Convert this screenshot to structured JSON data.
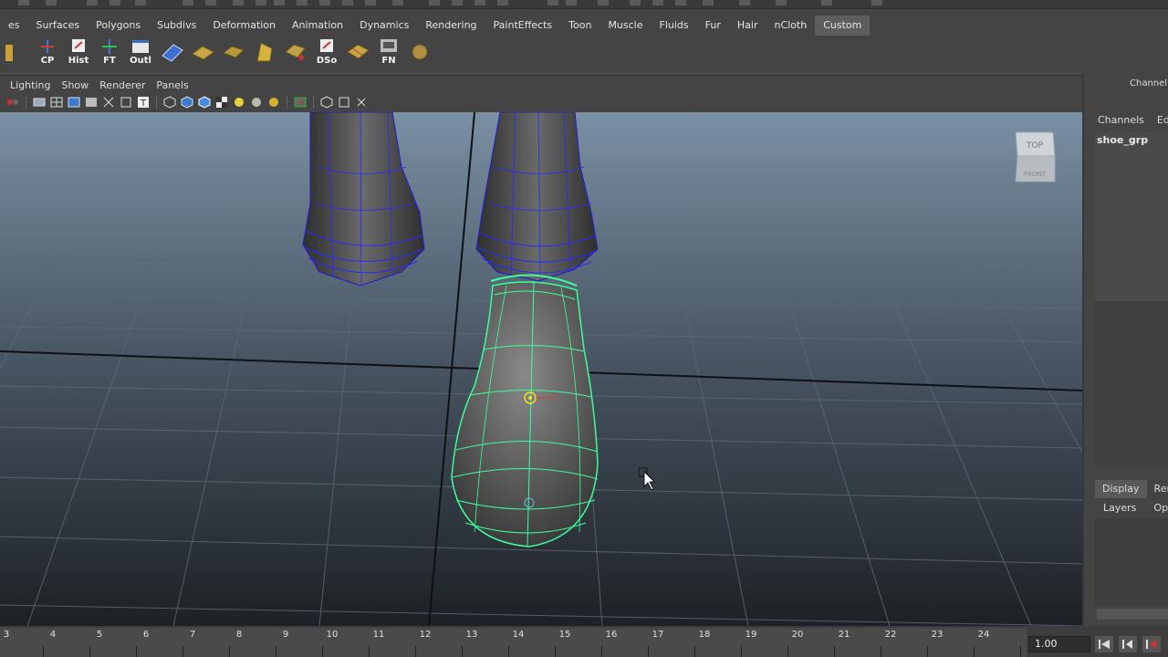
{
  "shelf_tabs": [
    "es",
    "Surfaces",
    "Polygons",
    "Subdivs",
    "Deformation",
    "Animation",
    "Dynamics",
    "Rendering",
    "PaintEffects",
    "Toon",
    "Muscle",
    "Fluids",
    "Fur",
    "Hair",
    "nCloth",
    "Custom"
  ],
  "active_shelf_tab": "Custom",
  "shelf_buttons": [
    {
      "label": "CP",
      "icon": "center-pivot-icon"
    },
    {
      "label": "Hist",
      "icon": "delete-history-icon"
    },
    {
      "label": "FT",
      "icon": "freeze-transforms-icon"
    },
    {
      "label": "Outl",
      "icon": "outliner-icon"
    },
    {
      "label": "DSo",
      "icon": "double-sided-icon"
    },
    {
      "label": "FN",
      "icon": "face-normals-icon"
    }
  ],
  "panel_menu": [
    "Lighting",
    "Show",
    "Renderer",
    "Panels"
  ],
  "viewcube": {
    "top": "TOP",
    "front": "FRONT"
  },
  "right_panel": {
    "title": "Channel Bo",
    "menu": [
      "Channels",
      "Edit"
    ],
    "selected_object": "shoe_grp",
    "layer_tabs": [
      "Display",
      "Ren"
    ],
    "layer_menu": [
      "Layers",
      "Option"
    ]
  },
  "timeline": {
    "ticks": [
      "3",
      "4",
      "5",
      "6",
      "7",
      "8",
      "9",
      "10",
      "11",
      "12",
      "13",
      "14",
      "15",
      "16",
      "17",
      "18",
      "19",
      "20",
      "21",
      "22",
      "23",
      "24"
    ],
    "current_time": "1.00"
  },
  "colors": {
    "selection": "#3dff9a",
    "wireframe": "#2a2aff",
    "viewport_top": "#6f8598",
    "viewport_bottom": "#1e2226"
  }
}
